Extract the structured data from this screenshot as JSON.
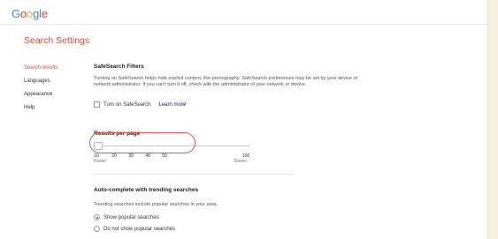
{
  "logo": {
    "letters": [
      "G",
      "o",
      "o",
      "g",
      "l",
      "e"
    ]
  },
  "page_title": "Search Settings",
  "nav": {
    "items": [
      {
        "label": "Search results",
        "active": true
      },
      {
        "label": "Languages",
        "active": false
      },
      {
        "label": "Appearance",
        "active": false
      },
      {
        "label": "Help",
        "active": false
      }
    ]
  },
  "safesearch": {
    "title": "SafeSearch Filters",
    "description": "Turning on SafeSearch helps hide explicit content, like pornography. SafeSearch preferences may be set by your device or network administrator. If you can't turn it off, check with the administrator of your network or device.",
    "checkbox_label": "Turn on SafeSearch",
    "checked": false,
    "learn_more": "Learn more"
  },
  "results_per_page": {
    "title": "Results per page",
    "ticks": [
      "10",
      "20",
      "30",
      "40",
      "50",
      "100"
    ],
    "selected": "10",
    "faster_label": "Faster",
    "slower_label": "Slower"
  },
  "autocomplete": {
    "title": "Auto-complete with trending searches",
    "description": "Trending searches include popular searches in your area.",
    "options": [
      {
        "label": "Show popular searches",
        "selected": true
      },
      {
        "label": "Do not show popular searches",
        "selected": false
      }
    ]
  },
  "colors": {
    "accent_red": "#dd4b39",
    "highlight_ring": "#e25a4e",
    "link_blue": "#1a0dab"
  }
}
